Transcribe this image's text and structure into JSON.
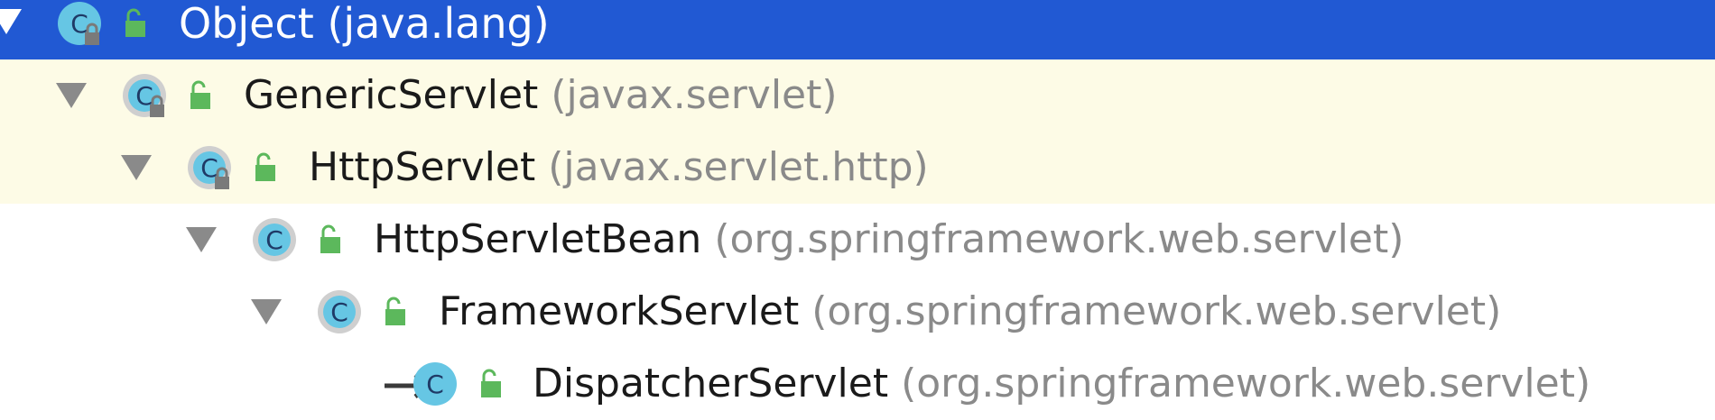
{
  "tree": {
    "rows": [
      {
        "name": "Object",
        "package": "(java.lang)",
        "state": "selected",
        "expanded": true,
        "class_badge": "C",
        "has_lock": true
      },
      {
        "name": "GenericServlet",
        "package": "(javax.servlet)",
        "state": "highlight",
        "expanded": true,
        "class_badge": "C",
        "has_lock": true
      },
      {
        "name": "HttpServlet",
        "package": "(javax.servlet.http)",
        "state": "highlight",
        "expanded": true,
        "class_badge": "C",
        "has_lock": true
      },
      {
        "name": "HttpServletBean",
        "package": "(org.springframework.web.servlet)",
        "state": "plain",
        "expanded": true,
        "class_badge": "C",
        "has_lock": false
      },
      {
        "name": "FrameworkServlet",
        "package": "(org.springframework.web.servlet)",
        "state": "plain",
        "expanded": true,
        "class_badge": "C",
        "has_lock": false
      },
      {
        "name": "DispatcherServlet",
        "package": "(org.springframework.web.servlet)",
        "state": "plain",
        "expanded": false,
        "class_badge": "C",
        "has_lock": false,
        "current": true
      }
    ]
  },
  "colors": {
    "selection": "#2159d3",
    "highlight": "#fdfbe6",
    "class_icon": "#66c6e4",
    "lock_green": "#5cb85c",
    "package_gray": "#8a8a8a"
  },
  "icons": {
    "toggle": "triangle-down-icon",
    "class": "class-c-icon",
    "access": "public-lock-icon",
    "abstract_lock": "gray-lock-icon",
    "current": "arrow-right-icon"
  }
}
